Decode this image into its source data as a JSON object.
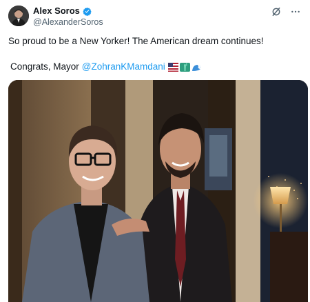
{
  "post": {
    "author_name": "Alex Soros",
    "author_handle": "@AlexanderSoros",
    "text_line1": "So proud to be a New Yorker! The American dream continues!",
    "text_line2_prefix": "Congrats, Mayor",
    "mention": "@ZohranKMamdani",
    "emoji_names": [
      "us-flag-emoji",
      "statue-of-liberty-emoji",
      "wave-emoji"
    ]
  },
  "icons": {
    "verified": "verified-badge-icon",
    "grok": "grok-icon",
    "more": "more-icon"
  },
  "colors": {
    "accent": "#1d9bf0",
    "secondary_text": "#536471",
    "text": "#0f1419"
  }
}
